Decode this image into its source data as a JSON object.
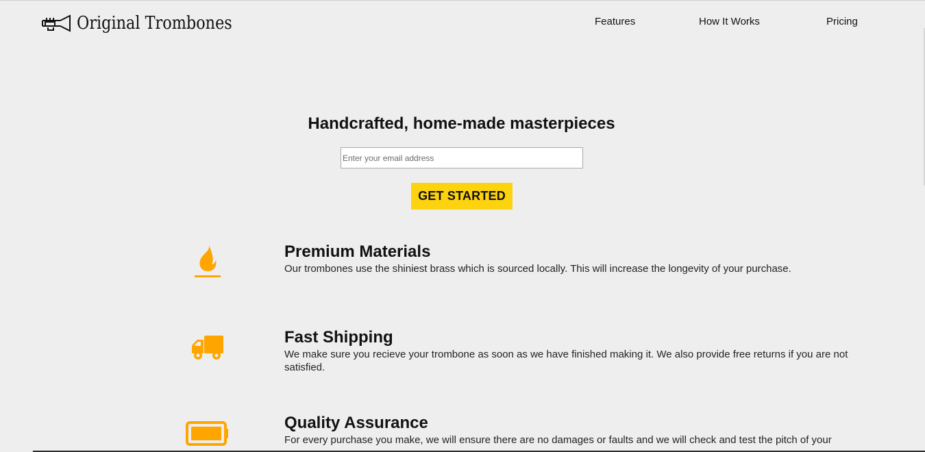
{
  "brand": {
    "name": "Original Trombones",
    "logo_icon": "trumpet-icon"
  },
  "nav": {
    "items": [
      {
        "label": "Features"
      },
      {
        "label": "How It Works"
      },
      {
        "label": "Pricing"
      }
    ]
  },
  "hero": {
    "title": "Handcrafted, home-made masterpieces",
    "email_placeholder": "Enter your email address",
    "email_value": "",
    "cta_label": "GET STARTED"
  },
  "features": [
    {
      "icon": "fire-icon",
      "title": "Premium Materials",
      "description": "Our trombones use the shiniest brass which is sourced locally. This will increase the longevity of your purchase."
    },
    {
      "icon": "truck-icon",
      "title": "Fast Shipping",
      "description": "We make sure you recieve your trombone as soon as we have finished making it. We also provide free returns if you are not satisfied."
    },
    {
      "icon": "battery-full-icon",
      "title": "Quality Assurance",
      "description": "For every purchase you make, we will ensure there are no damages or faults and we will check and test the pitch of your"
    }
  ],
  "colors": {
    "background": "#eeeeee",
    "accent_yellow": "#fdd20e",
    "icon_orange": "#ffa500",
    "text": "#111111"
  }
}
